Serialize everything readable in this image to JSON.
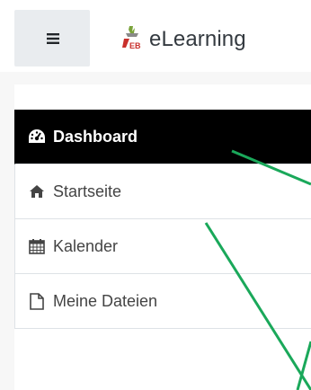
{
  "header": {
    "menu_icon": "hamburger-icon",
    "brand_icon": "elearning-logo-icon",
    "brand_name": "eLearning",
    "logo_text": "EB"
  },
  "nav": {
    "items": [
      {
        "label": "Dashboard",
        "icon": "dashboard-icon",
        "active": true
      },
      {
        "label": "Startseite",
        "icon": "home-icon",
        "active": false
      },
      {
        "label": "Kalender",
        "icon": "calendar-icon",
        "active": false
      },
      {
        "label": "Meine Dateien",
        "icon": "file-icon",
        "active": false
      }
    ]
  },
  "colors": {
    "active_bg": "#000000",
    "annotation_line": "#1aa85a",
    "menu_button_bg": "#e9ecef"
  }
}
